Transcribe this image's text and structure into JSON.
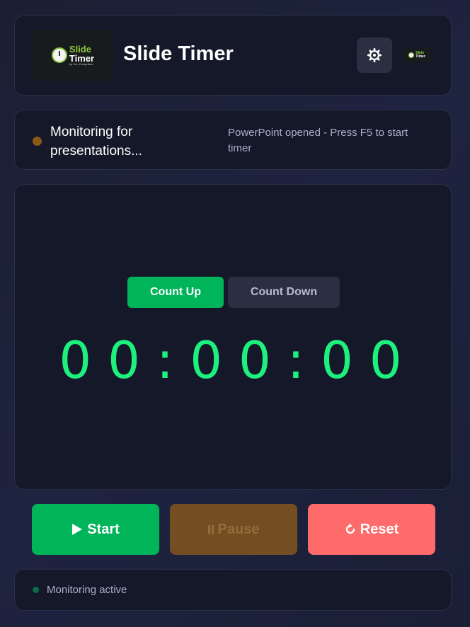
{
  "header": {
    "title": "Slide Timer",
    "logo": {
      "line1": "Slide",
      "line2": "Timer",
      "byline": "by Cun Computers"
    },
    "mini_logo": {
      "line1": "Slide",
      "line2": "Timer"
    },
    "settings_icon": "gear-icon"
  },
  "status": {
    "text": "Monitoring for presentations...",
    "detail": "PowerPoint opened - Press F5 to start timer",
    "dot_color": "#8a5a1a"
  },
  "timer": {
    "mode_up_label": "Count Up",
    "mode_down_label": "Count Down",
    "active_mode": "Count Up",
    "display": "00:00:00",
    "display_color": "#1ef07e"
  },
  "controls": {
    "start_label": "Start",
    "pause_label": "Pause",
    "reset_label": "Reset",
    "start_icon": "play-icon",
    "pause_icon": "pause-icon",
    "reset_icon": "refresh-icon",
    "colors": {
      "start": "#00b45a",
      "pause": "#744e22",
      "reset": "#ff6b6b"
    }
  },
  "footer": {
    "status_text": "Monitoring active",
    "dot_color": "#0d6b46"
  }
}
